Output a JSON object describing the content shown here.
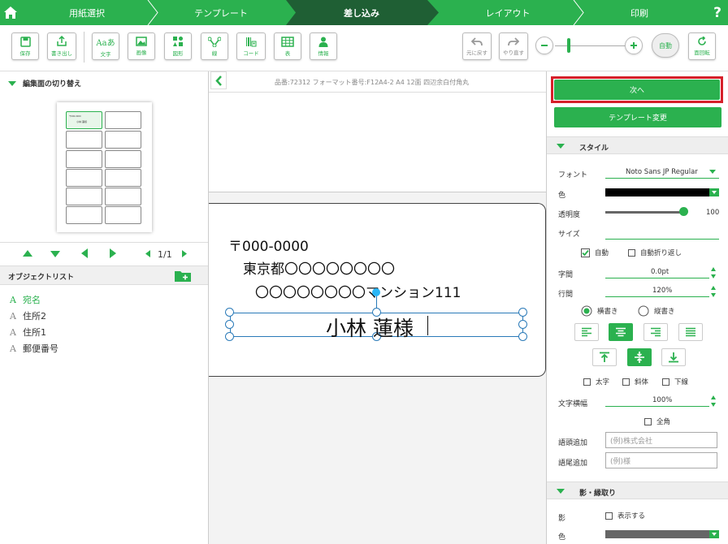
{
  "colors": {
    "accent": "#2bb14f",
    "dark_step": "#1f5f34",
    "highlight_border": "#d6202a",
    "selection": "#2a7ab8"
  },
  "nav": {
    "steps": [
      "用紙選択",
      "テンプレート",
      "差し込み",
      "レイアウト",
      "印刷"
    ],
    "active_index": 2,
    "help": "?"
  },
  "toolbar": {
    "buttons": [
      {
        "icon": "save-icon",
        "label": "保存"
      },
      {
        "icon": "export-icon",
        "label": "書き出し"
      },
      {
        "icon": "text-icon",
        "label": "文字",
        "glyph": "Aaあ"
      },
      {
        "icon": "image-icon",
        "label": "画像"
      },
      {
        "icon": "shape-icon",
        "label": "図形"
      },
      {
        "icon": "line-icon",
        "label": "線"
      },
      {
        "icon": "barcode-icon",
        "label": "コード"
      },
      {
        "icon": "table-icon",
        "label": "表"
      },
      {
        "icon": "info-icon",
        "label": "情報"
      }
    ],
    "undo": "元に戻す",
    "redo": "やり直す",
    "auto": "自動",
    "rotate": "面回転",
    "zoom_level": 0.2
  },
  "left": {
    "editing_surface_title": "編集面の切り替え",
    "thumb_texts": [
      "〒000-0000",
      "小林 蓮様"
    ],
    "page_indicator": "1/1",
    "object_list_title": "オブジェクトリスト",
    "objects": [
      "宛名",
      "住所2",
      "住所1",
      "郵便番号"
    ],
    "object_glyph": "A"
  },
  "center": {
    "product_info": "品番:72312 フォーマット番号:F12A4-2 A4 12面 四辺余白付角丸",
    "label": {
      "postal": "〒000-0000",
      "address1": "東京都〇〇〇〇〇〇〇〇",
      "address2": "〇〇〇〇〇〇〇〇マンション111",
      "name": "小林 蓮様"
    }
  },
  "right": {
    "next": "次へ",
    "template_change": "テンプレート変更",
    "style_title": "スタイル",
    "font_label": "フォント",
    "font_value": "Noto Sans JP Regular",
    "color_label": "色",
    "color_value": "#000000",
    "opacity_label": "透明度",
    "opacity_value": "100",
    "opacity_fraction": 1.0,
    "size_label": "サイズ",
    "auto_label": "自動",
    "auto_checked": true,
    "wrap_label": "自動折り返し",
    "char_spacing_label": "字間",
    "char_spacing_value": "0.0pt",
    "line_spacing_label": "行間",
    "line_spacing_value": "120%",
    "horizontal": "横書き",
    "vertical": "縦書き",
    "bold": "太字",
    "italic": "斜体",
    "underline": "下線",
    "char_width_label": "文字横幅",
    "char_width_value": "100%",
    "fullwidth": "全角",
    "prefix_label": "語頭追加",
    "prefix_placeholder": "(例)株式会社",
    "suffix_label": "語尾追加",
    "suffix_placeholder": "(例)様",
    "shadow_title": "影・縁取り",
    "shadow_label": "影",
    "shadow_show": "表示する",
    "shadow_color_label": "色",
    "shadow_color": "#666666"
  }
}
